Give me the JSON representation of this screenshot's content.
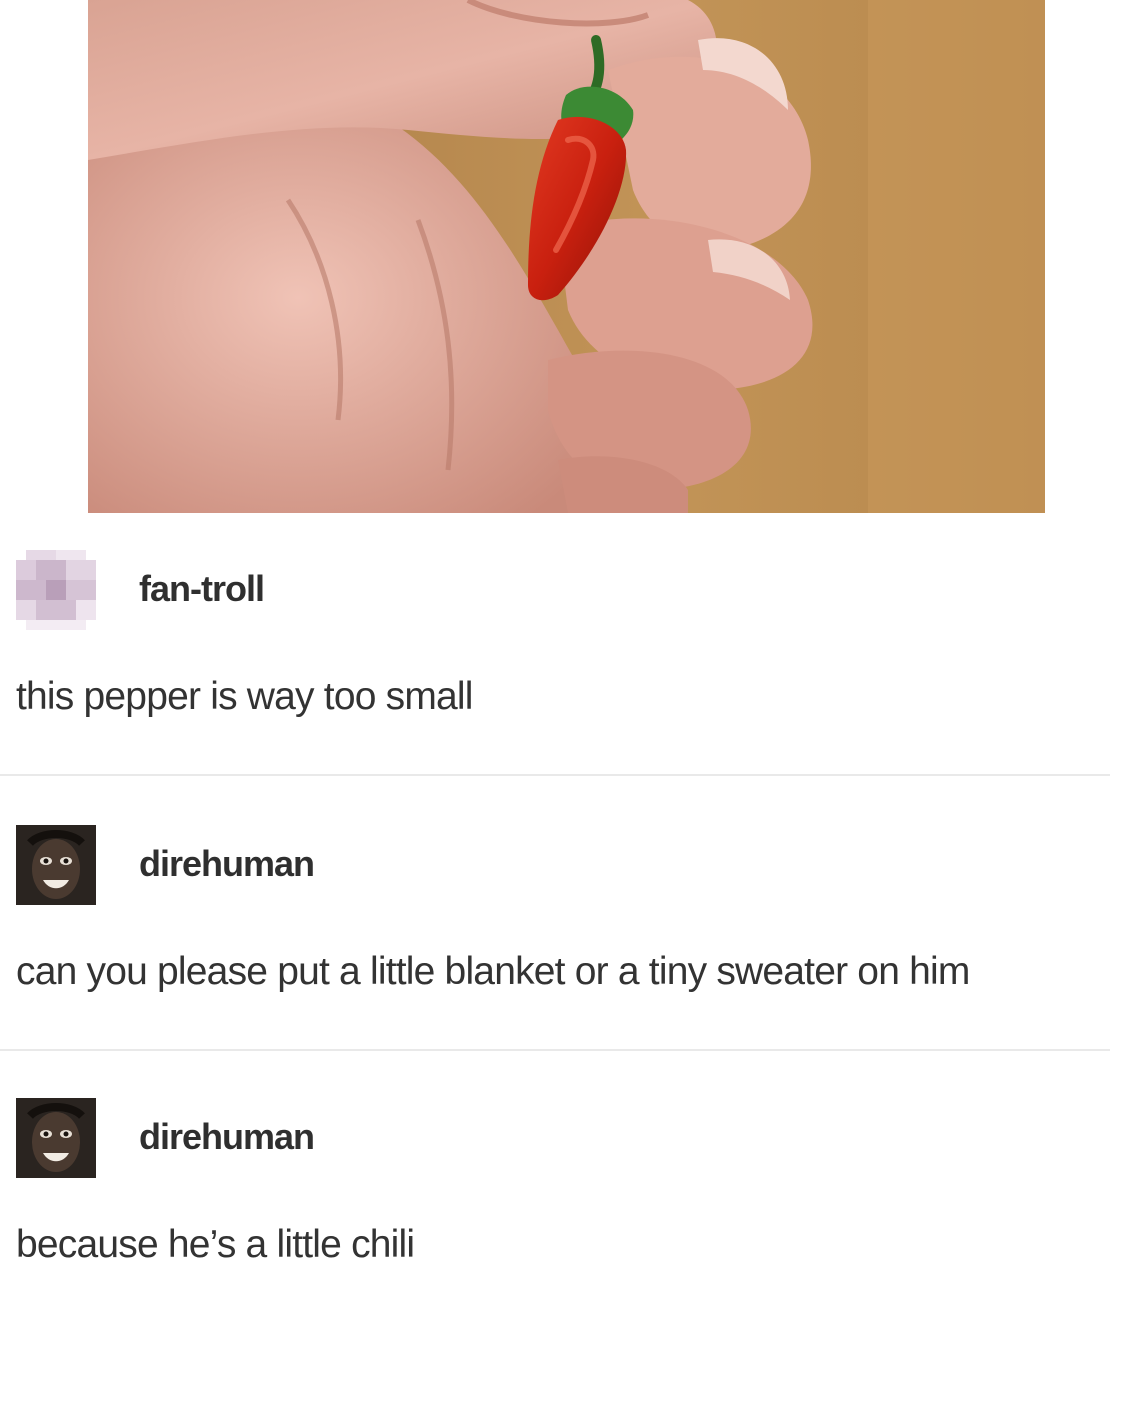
{
  "post": {
    "photo_icon": "chili-pepper-photo"
  },
  "entries": [
    {
      "username": "fan-troll",
      "message": "this pepper is way too small",
      "avatar_icon": "pixelated-avatar"
    },
    {
      "username": "direhuman",
      "message": "can you please put a little blanket or a tiny sweater on him",
      "avatar_icon": "face-avatar"
    },
    {
      "username": "direhuman",
      "message": "because he’s a little chili",
      "avatar_icon": "face-avatar"
    }
  ]
}
